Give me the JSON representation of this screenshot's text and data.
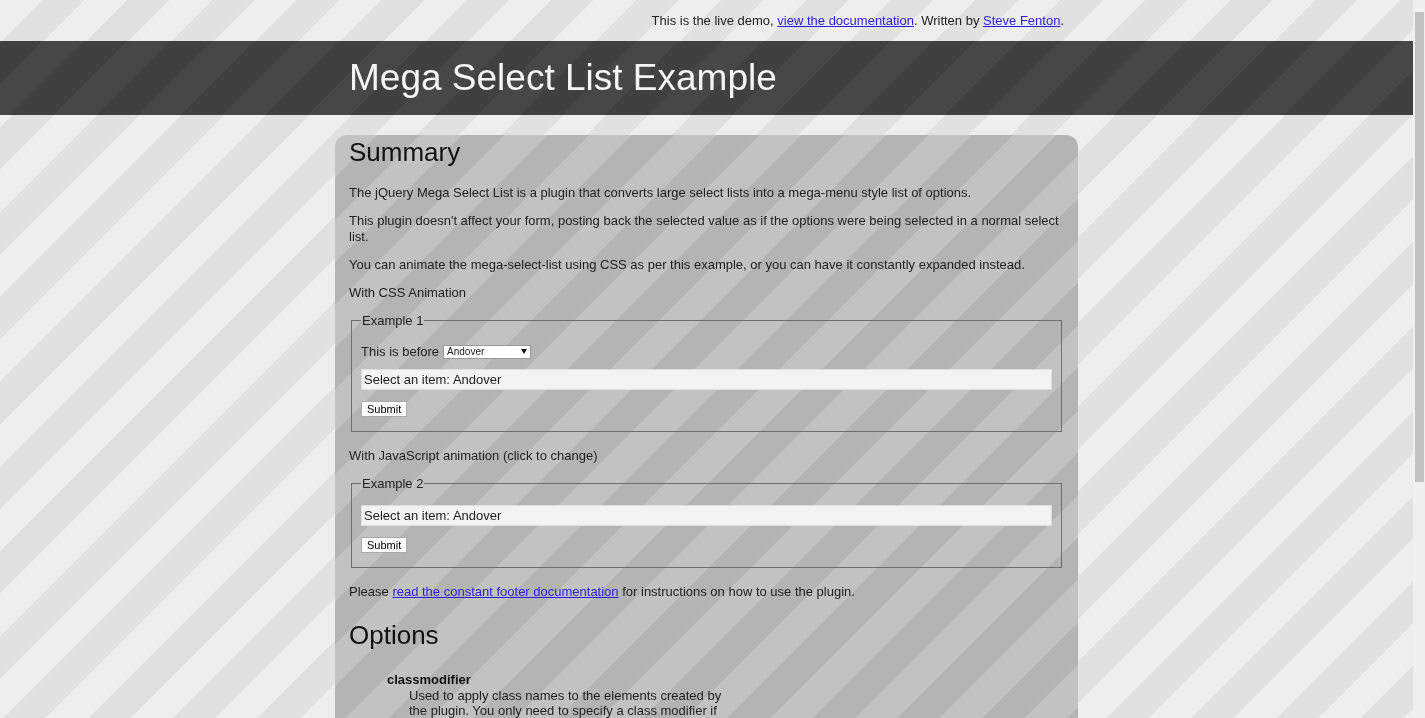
{
  "top_note": {
    "before": "This is the live demo, ",
    "link_1": "view the documentation",
    "middle": ". Written by ",
    "link_2": "Steve Fenton",
    "after": "."
  },
  "header": {
    "title": "Mega Select List Example"
  },
  "summary": {
    "heading": "Summary",
    "paragraphs": [
      "The jQuery Mega Select List is a plugin that converts large select lists into a mega-menu style list of options.",
      "This plugin doesn't affect your form, posting back the selected value as if the options were being selected in a normal select list.",
      "You can animate the mega-select-list using CSS as per this example, or you can have it constantly expanded instead."
    ],
    "css_label": "With CSS Animation",
    "example_1": {
      "legend": "Example 1",
      "select_label": "This is before",
      "select_value": "Andover",
      "field_value": "Select an item: Andover",
      "button": "Submit"
    },
    "js_label": "With JavaScript animation (click to change)",
    "example_2": {
      "legend": "Example 2",
      "field_value": "Select an item: Andover",
      "button": "Submit"
    },
    "footer_note": {
      "before": "Please ",
      "link": "read the constant footer documentation",
      "after": " for instructions on how to use the plugin."
    }
  },
  "options": {
    "heading": "Options",
    "items": [
      {
        "name": "classmodifier",
        "description": "Used to apply class names to the elements created by the plugin. You only need to specify a class modifier if"
      }
    ]
  }
}
